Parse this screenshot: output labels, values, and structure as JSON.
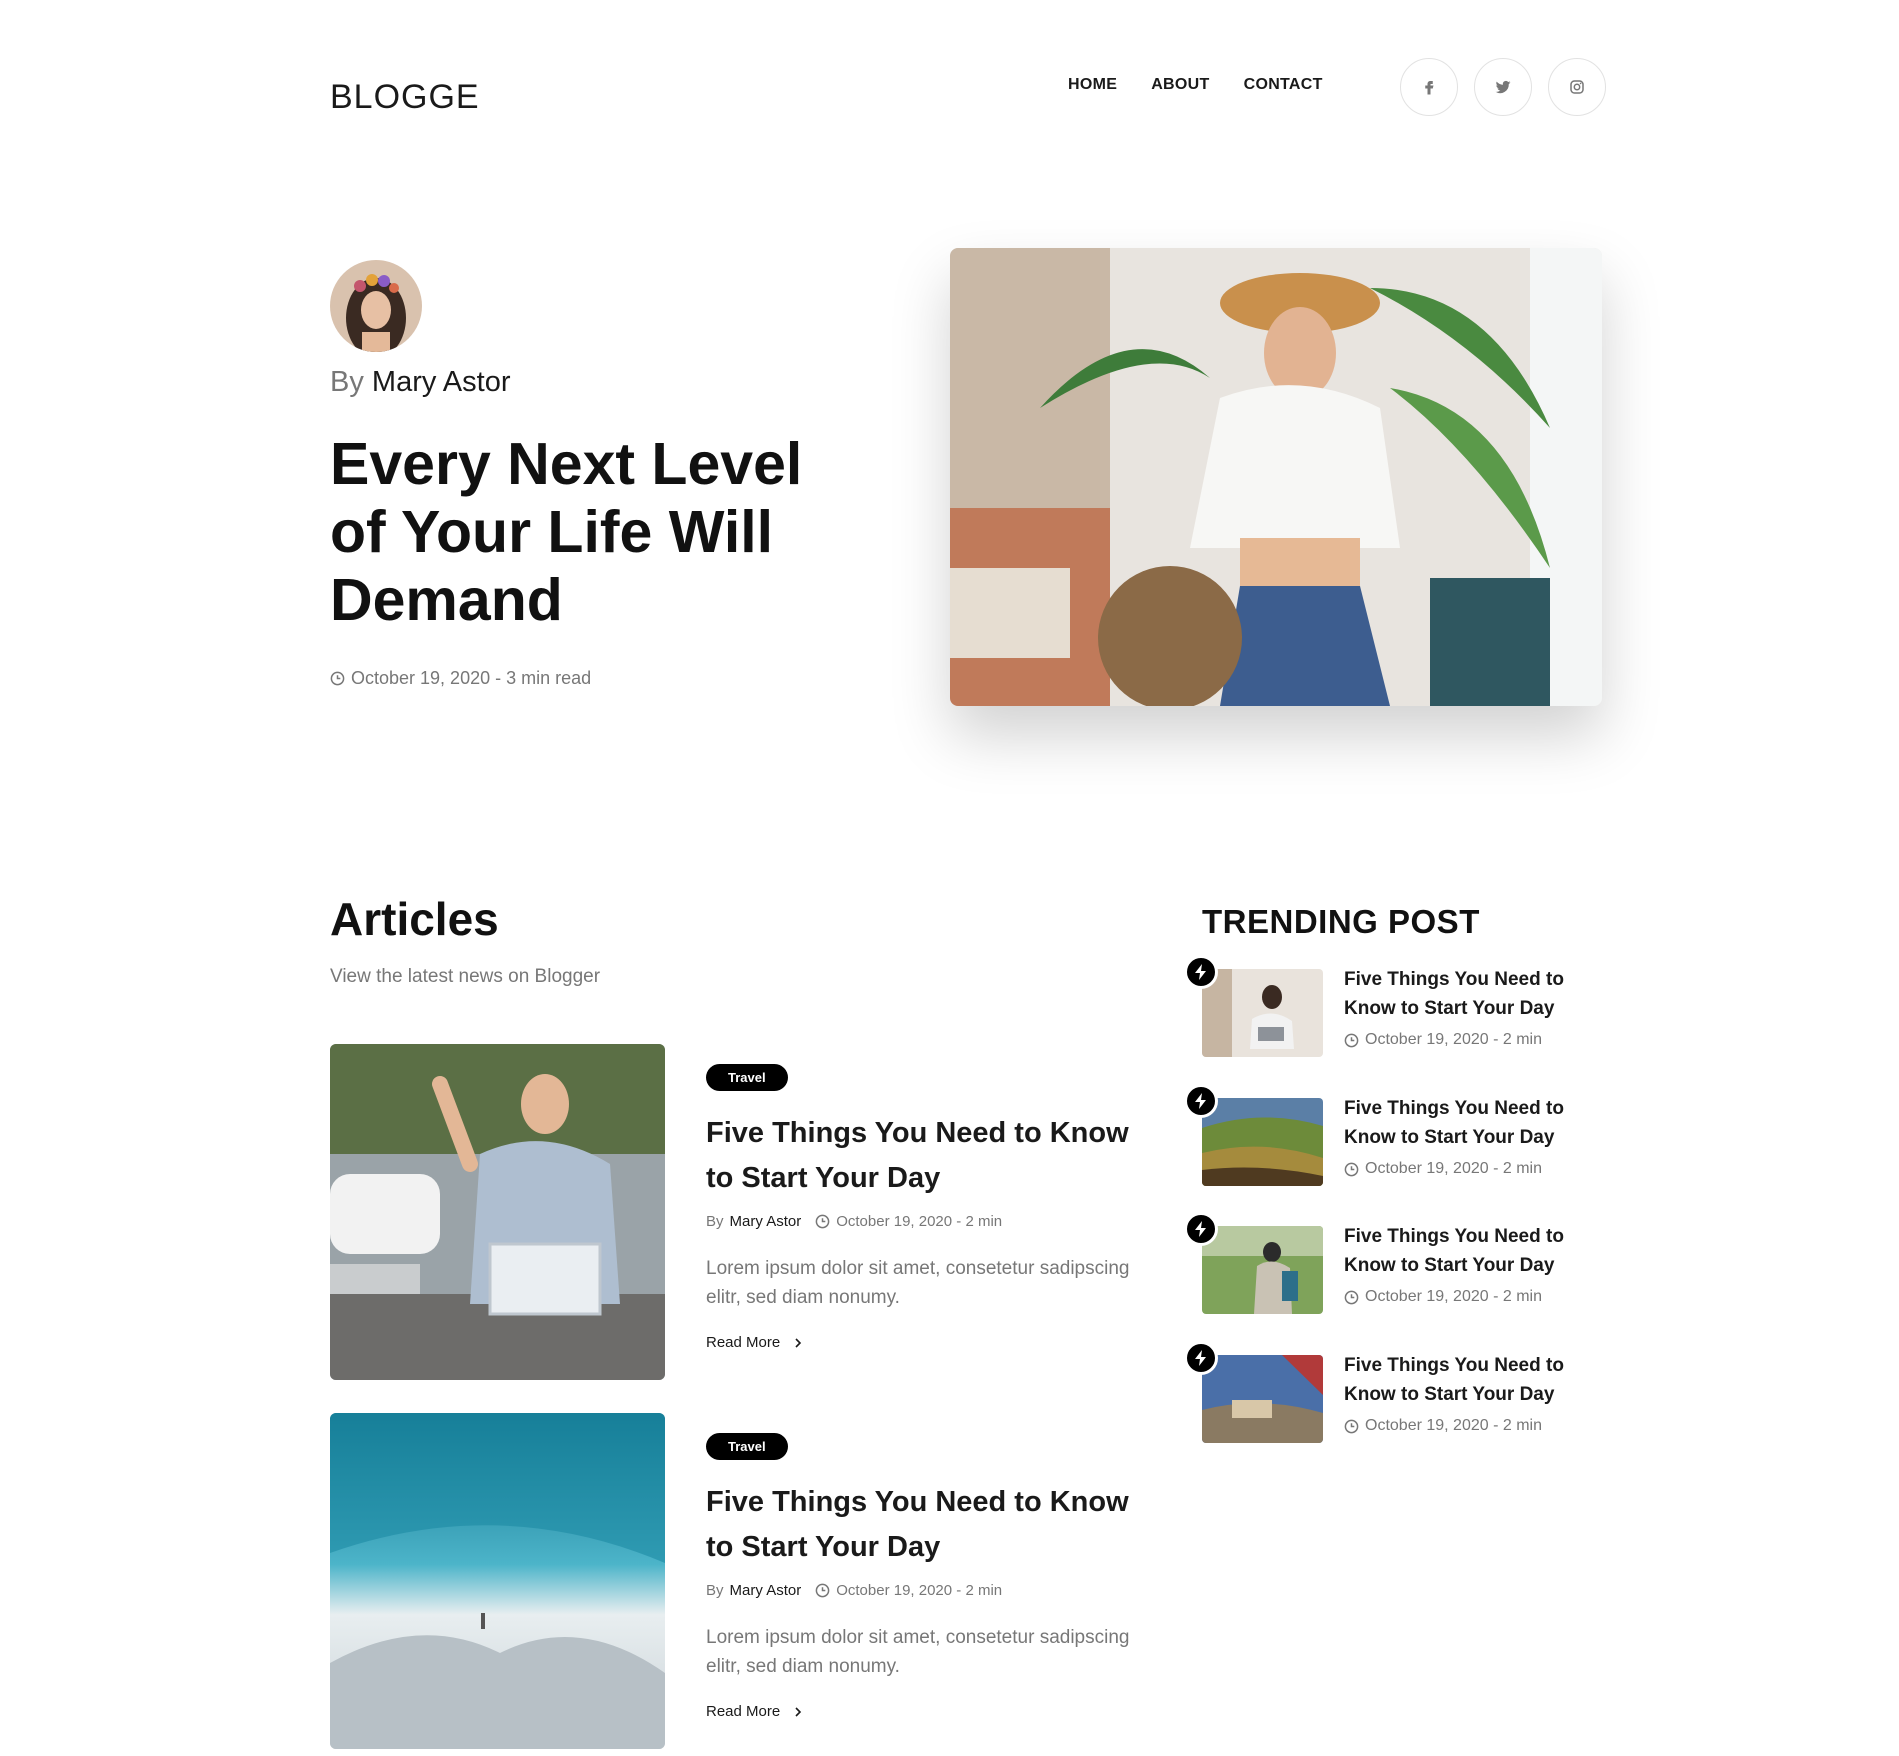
{
  "header": {
    "logo": "BLOGGE",
    "nav": [
      "HOME",
      "ABOUT",
      "CONTACT"
    ],
    "socials": [
      "facebook-icon",
      "twitter-icon",
      "instagram-icon"
    ]
  },
  "hero": {
    "by_prefix": "By",
    "author": "Mary Astor",
    "title": "Every Next Level of Your Life Will Demand",
    "meta": "October 19, 2020 - 3 min read"
  },
  "articles": {
    "title": "Articles",
    "subtitle": "View the latest news on Blogger",
    "items": [
      {
        "tag": "Travel",
        "title": "Five Things You Need to Know to Start Your Day",
        "by_prefix": "By",
        "author": "Mary Astor",
        "meta": "October 19, 2020 - 2 min",
        "excerpt": "Lorem ipsum dolor sit amet, consetetur sadipscing elitr, sed diam nonumy.",
        "read_more": "Read More"
      },
      {
        "tag": "Travel",
        "title": "Five Things You Need to Know to Start Your Day",
        "by_prefix": "By",
        "author": "Mary Astor",
        "meta": "October 19, 2020 - 2 min",
        "excerpt": "Lorem ipsum dolor sit amet, consetetur sadipscing elitr, sed diam nonumy.",
        "read_more": "Read More"
      }
    ]
  },
  "trending": {
    "title": "TRENDING POST",
    "items": [
      {
        "title": "Five Things You Need to Know to Start Your Day",
        "meta": "October 19, 2020 - 2 min"
      },
      {
        "title": "Five Things You Need to Know to Start Your Day",
        "meta": "October 19, 2020 - 2 min"
      },
      {
        "title": "Five Things You Need to Know to Start Your Day",
        "meta": "October 19, 2020 - 2 min"
      },
      {
        "title": "Five Things You Need to Know to Start Your Day",
        "meta": "October 19, 2020 - 2 min"
      }
    ]
  }
}
